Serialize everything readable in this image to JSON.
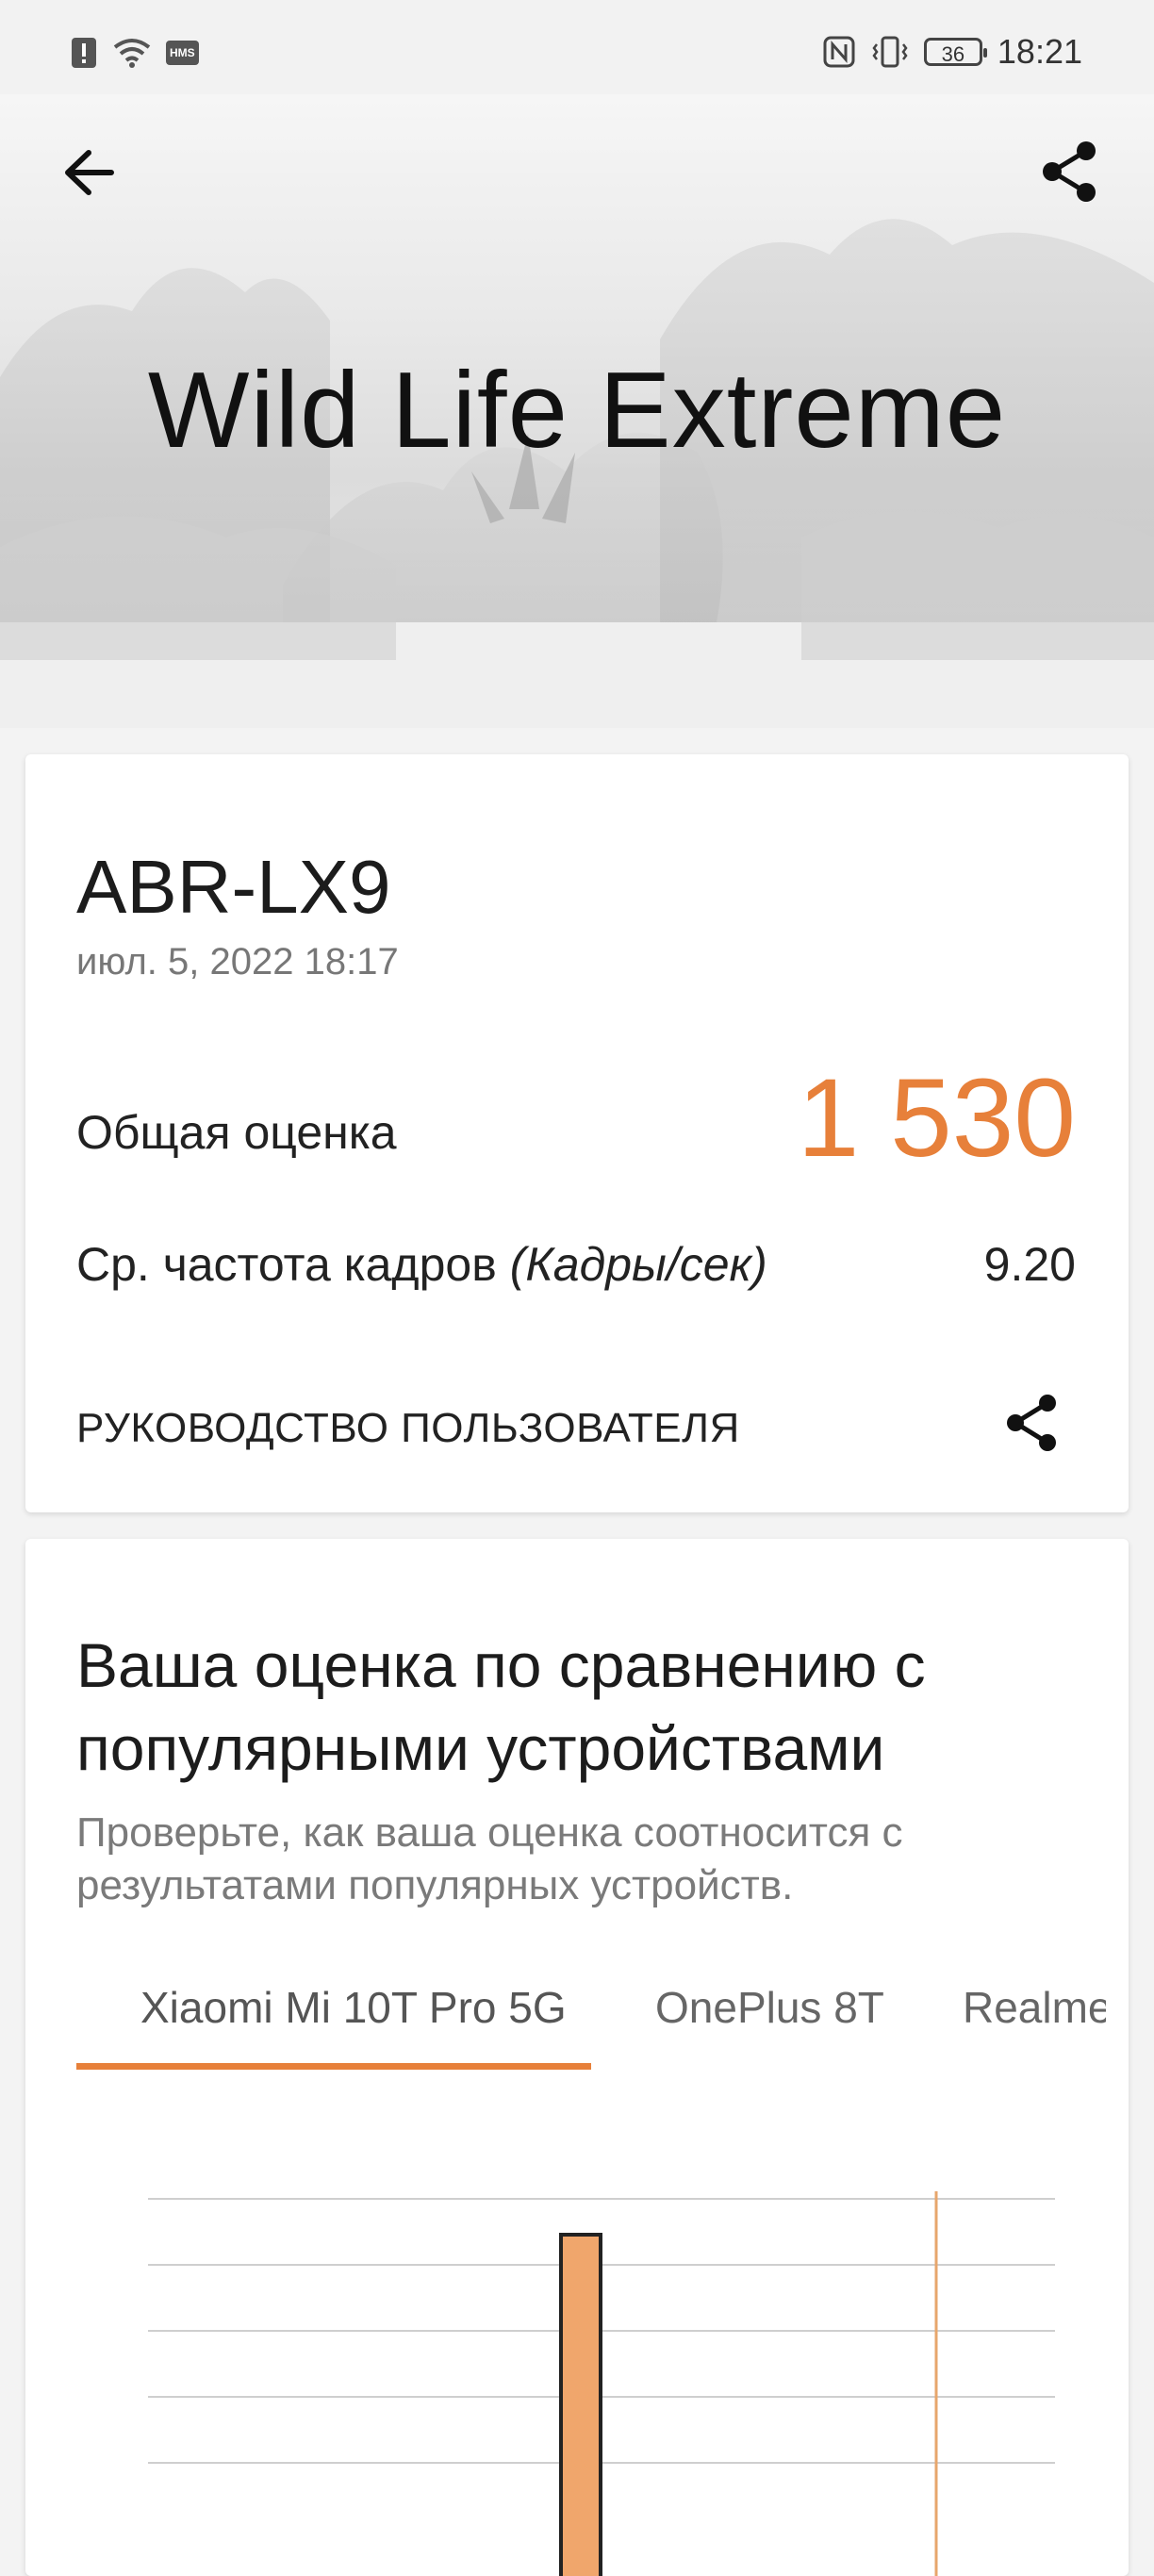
{
  "status_bar": {
    "time": "18:21",
    "battery": "36",
    "left_icons": [
      "alert-icon",
      "wifi-icon",
      "hms-icon"
    ],
    "hms_label": "HMS",
    "right_icons": [
      "nfc-icon",
      "vibrate-icon",
      "battery-icon"
    ]
  },
  "header": {
    "title": "Wild Life Extreme",
    "back_icon": "arrow-left-icon",
    "share_icon": "share-icon"
  },
  "result_card": {
    "device": "ABR-LX9",
    "date": "июл. 5, 2022 18:17",
    "score_label": "Общая оценка",
    "score_value": "1 530",
    "fps_label": "Ср. частота кадров",
    "fps_unit": "(Кадры/сек)",
    "fps_value": "9.20",
    "guide_label": "РУКОВОДСТВО ПОЛЬЗОВАТЕЛЯ"
  },
  "compare_card": {
    "title": "Ваша оценка по сравнению с популярными устройствами",
    "subtitle": "Проверьте, как ваша оценка соотносится с результатами популярных устройств.",
    "tabs": [
      "Xiaomi Mi 10T Pro 5G",
      "OnePlus 8T",
      "Realme"
    ],
    "active_tab": 0
  },
  "colors": {
    "accent": "#e7803a",
    "bar_fill": "#f0a66c",
    "text_primary": "#1f1f1f",
    "text_secondary": "#777777"
  }
}
